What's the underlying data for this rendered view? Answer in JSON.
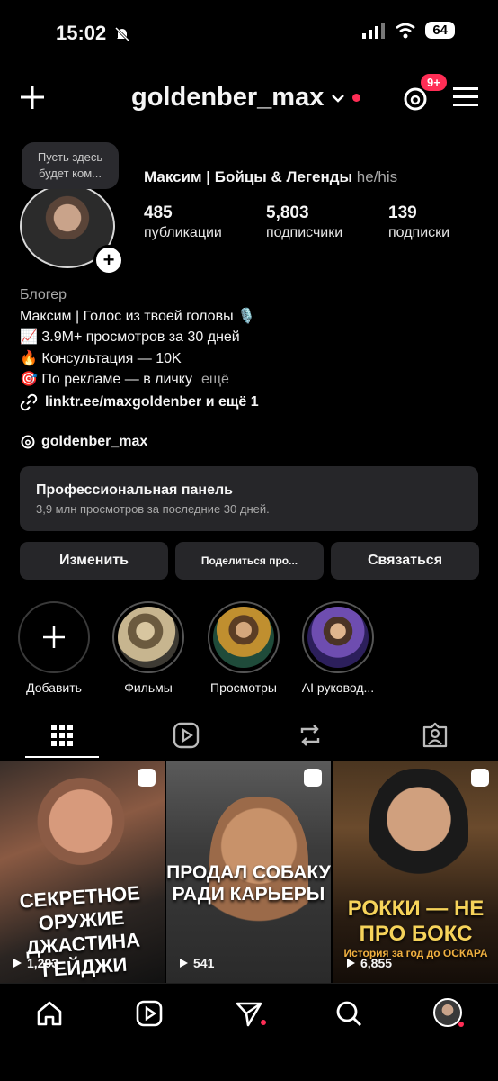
{
  "status_bar": {
    "time": "15:02",
    "battery": "64"
  },
  "header": {
    "username": "goldenber_max",
    "notification_badge": "9+"
  },
  "profile": {
    "note": "Пусть здесь будет ком...",
    "full_name": "Максим | Бойцы & Легенды",
    "pronouns": "he/his",
    "stats": [
      {
        "value": "485",
        "label": "публикации"
      },
      {
        "value": "5,803",
        "label": "подписчики"
      },
      {
        "value": "139",
        "label": "подписки"
      }
    ],
    "category": "Блогер",
    "bio_lines": [
      "Максим | Голос из твоей головы 🎙️",
      "📈 3.9M+ просмотров за 30 дней",
      "🔥 Консультация — 10K",
      "🎯 По рекламе — в личку"
    ],
    "bio_more": "ещё",
    "link": "linktr.ee/maxgoldenber и ещё 1",
    "threads_handle": "goldenber_max"
  },
  "pro_panel": {
    "title": "Профессиональная панель",
    "subtitle": "3,9 млн просмотров за последние 30 дней."
  },
  "buttons": {
    "edit": "Изменить",
    "share": "Поделиться про...",
    "contact": "Связаться"
  },
  "highlights": [
    {
      "label": "Добавить"
    },
    {
      "label": "Фильмы"
    },
    {
      "label": "Просмотры"
    },
    {
      "label": "AI руковод..."
    }
  ],
  "posts": [
    {
      "caption": "СЕКРЕТНОЕ ОРУЖИЕ ДЖАСТИНА ГЕЙДЖИ",
      "views": "1,293"
    },
    {
      "caption": "ПРОДАЛ СОБАКУ РАДИ КАРЬЕРЫ",
      "views": "541"
    },
    {
      "caption": "РОККИ — НЕ ПРО БОКС",
      "subcaption": "История за год до ОСКАРА",
      "views": "6,855"
    }
  ],
  "colors": {
    "accent_red": "#ff2d55",
    "panel_bg": "#262629"
  }
}
